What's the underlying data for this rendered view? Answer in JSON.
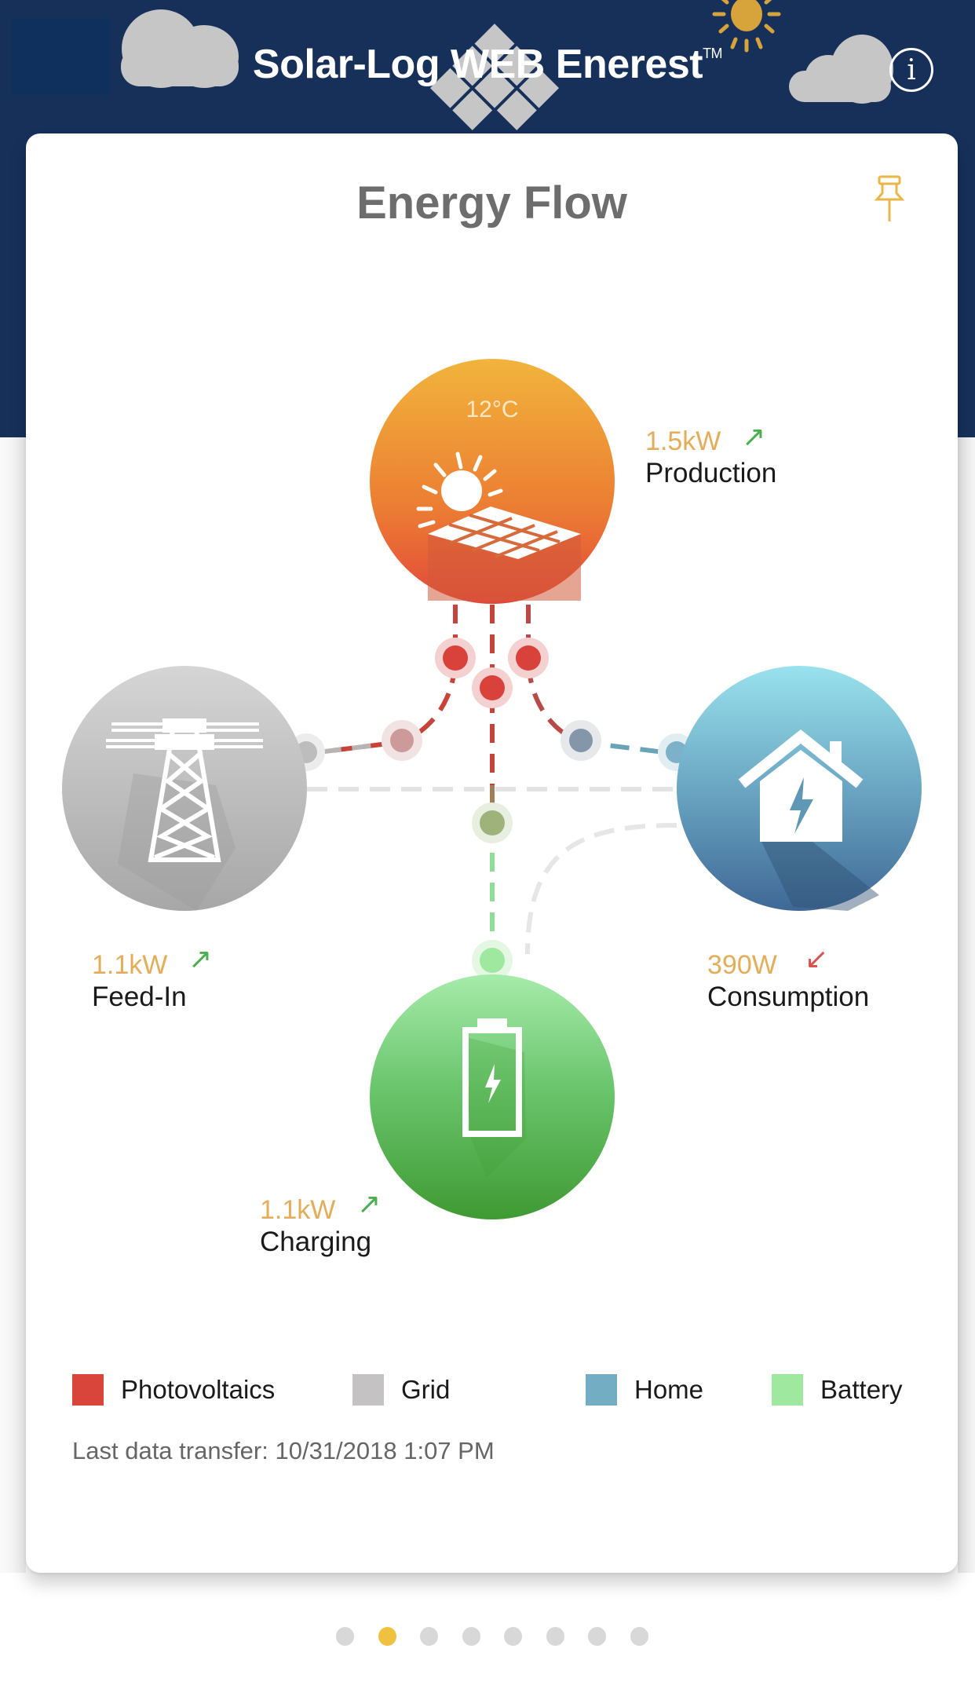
{
  "header": {
    "title": "Solar-Log WEB Enerest",
    "trademark": "TM",
    "info_icon": "info-icon",
    "info_glyph": "i",
    "background_color": "#16305a"
  },
  "card": {
    "title": "Energy Flow",
    "pin_icon": "pushpin-icon"
  },
  "nodes": {
    "production": {
      "temperature": "12°C",
      "value": "1.5kW",
      "label": "Production",
      "trend": "up",
      "trend_glyph": "↗",
      "trend_color": "#4caf50",
      "icon": "solar-panel-icon"
    },
    "grid": {
      "value": "1.1kW",
      "label": "Feed-In",
      "trend": "up",
      "trend_glyph": "↗",
      "trend_color": "#4caf50",
      "icon": "power-tower-icon"
    },
    "home": {
      "value": "390W",
      "label": "Consumption",
      "trend": "down",
      "trend_glyph": "↙",
      "trend_color": "#d9534f",
      "icon": "house-lightning-icon"
    },
    "battery": {
      "value": "1.1kW",
      "label": "Charging",
      "trend": "up",
      "trend_glyph": "↗",
      "trend_color": "#4caf50",
      "icon": "battery-charging-icon"
    }
  },
  "legend": [
    {
      "label": "Photovoltaics",
      "color": "#d9453a"
    },
    {
      "label": "Grid",
      "color": "#c4c2c2"
    },
    {
      "label": "Home",
      "color": "#72adc3"
    },
    {
      "label": "Battery",
      "color": "#9fe8a0"
    }
  ],
  "last_transfer": "Last data transfer: 10/31/2018 1:07 PM",
  "pager": {
    "total": 8,
    "active_index": 1
  },
  "colors": {
    "value_text": "#e3ad5a",
    "title_text": "#6d6d6d",
    "accent_yellow": "#f0c040"
  }
}
